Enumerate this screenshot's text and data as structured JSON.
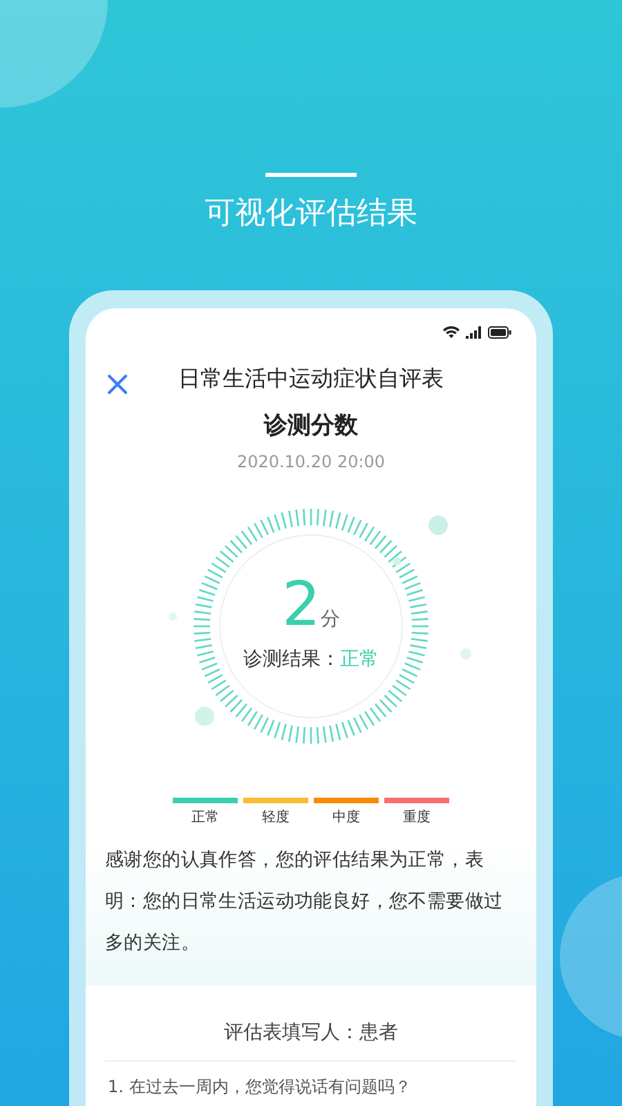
{
  "heading": "可视化评估结果",
  "header": {
    "title": "日常生活中运动症状自评表"
  },
  "subtitle": "诊测分数",
  "date": "2020.10.20 20:00",
  "score": {
    "value": "2",
    "unit": "分",
    "result_label": "诊测结果：",
    "result": "正常"
  },
  "scale": [
    {
      "label": "正常",
      "color": "#3ccfae"
    },
    {
      "label": "轻度",
      "color": "#fbbb35"
    },
    {
      "label": "中度",
      "color": "#fb8a05"
    },
    {
      "label": "重度",
      "color": "#f96f6f"
    }
  ],
  "summary": "感谢您的认真作答，您的评估结果为正常，表明：您的日常生活运动功能良好，您不需要做过多的关注。",
  "filler": "评估表填写人：患者",
  "questions": [
    "1. 在过去一周内，您觉得说话有问题吗？"
  ]
}
